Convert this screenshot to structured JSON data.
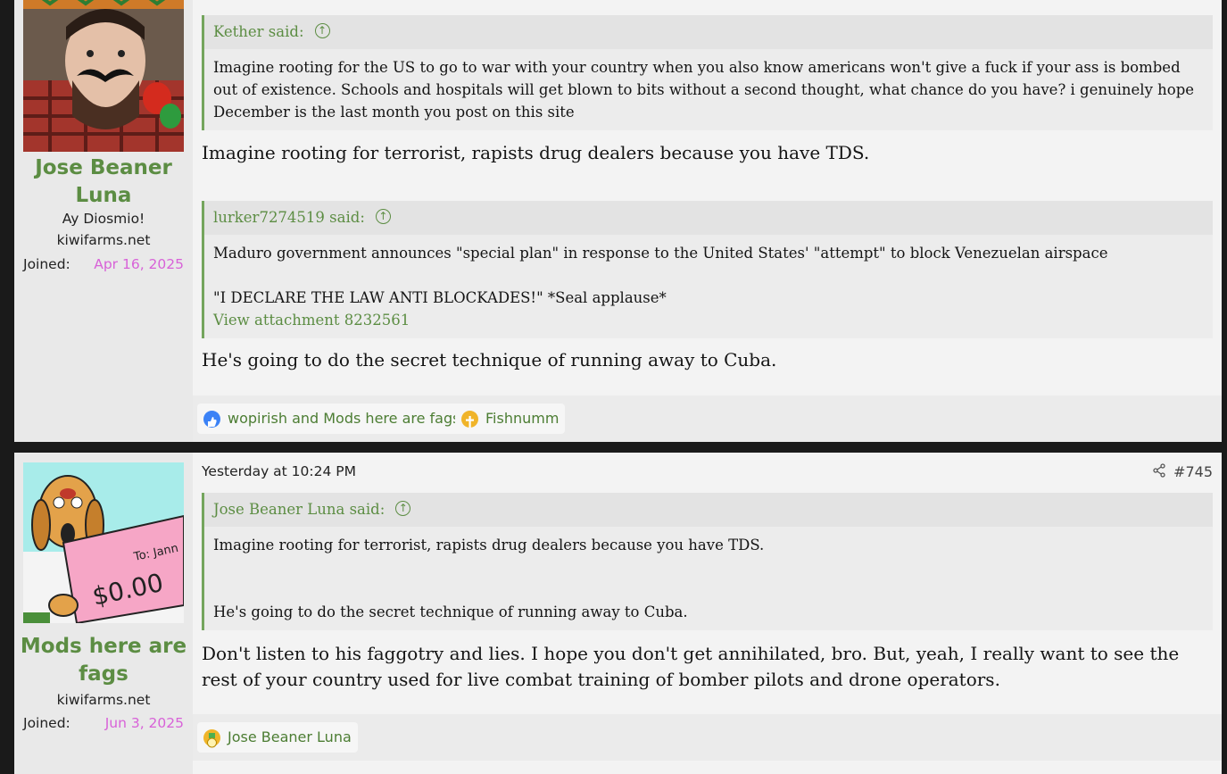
{
  "posts": [
    {
      "user": {
        "name": "Jose Beaner Luna",
        "title": "Ay Diosmio!",
        "site": "kiwifarms.net",
        "joined_label": "Joined:",
        "joined_date": "Apr 16, 2025"
      },
      "quotes": [
        {
          "author": "Kether said:",
          "text": "Imagine rooting for the US to go to war with your country when you also know americans won't give a fuck if your ass is bombed out of existence. Schools and hospitals will get blown to bits without a second thought, what chance do you have? i genuinely hope December is the last month you post on this site"
        },
        {
          "author": "lurker7274519 said:",
          "line1": "Maduro government announces \"special plan\" in response to the United States' \"attempt\" to block Venezuelan airspace",
          "line2": "\"I DECLARE THE LAW ANTI BLOCKADES!\" *Seal applause*",
          "attachment": "View attachment 8232561"
        }
      ],
      "reply1": "Imagine rooting for terrorist, rapists drug dealers because you have TDS.",
      "reply2": "He's going to do the secret technique of running away to Cuba.",
      "reactions": [
        {
          "icon": "like-icon",
          "text": "wopirish and Mods here are fags"
        },
        {
          "icon": "cross-icon",
          "text": "Fishnumm"
        }
      ]
    },
    {
      "user": {
        "name": "Mods here are fags",
        "site": "kiwifarms.net",
        "joined_label": "Joined:",
        "joined_date": "Jun 3, 2025"
      },
      "date": "Yesterday at 10:24 PM",
      "number": "#745",
      "quote": {
        "author": "Jose Beaner Luna said:",
        "line1": "Imagine rooting for terrorist, rapists drug dealers because you have TDS.",
        "line2": "He's going to do the secret technique of running away to Cuba."
      },
      "reply": "Don't listen to his faggotry and lies. I hope you don't get annihilated, bro. But, yeah, I really want to see the rest of your country used for live combat training of bomber pilots and drone operators.",
      "reactions": [
        {
          "icon": "medal-icon",
          "text": "Jose Beaner Luna"
        }
      ]
    }
  ],
  "colors": {
    "username": "#5c8d43",
    "joined_date": "#d862d8",
    "quote_border": "#74a55d"
  }
}
